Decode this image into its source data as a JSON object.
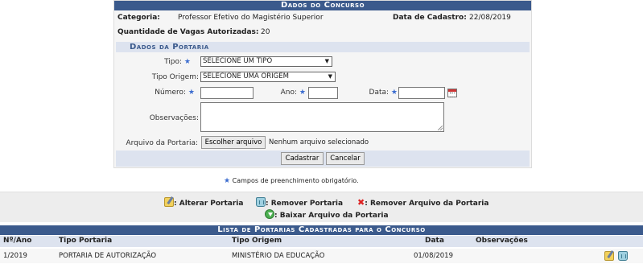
{
  "panel": {
    "title": "Dados do Concurso",
    "categoria_label": "Categoria:",
    "categoria_value": "Professor Efetivo do Magistério Superior",
    "data_cadastro_label": "Data de Cadastro:",
    "data_cadastro_value": "22/08/2019",
    "vagas_label": "Quantidade de Vagas Autorizadas:",
    "vagas_value": "20"
  },
  "portaria": {
    "title": "Dados da Portaria",
    "tipo_label": "Tipo:",
    "tipo_value": "SELECIONE UM TIPO",
    "tipo_origem_label": "Tipo Origem:",
    "tipo_origem_value": "SELECIONE UMA ORIGEM",
    "numero_label": "Número:",
    "ano_label": "Ano:",
    "data_label": "Data:",
    "observacoes_label": "Observações:",
    "arquivo_label": "Arquivo da Portaria:",
    "file_button": "Escolher arquivo",
    "file_status": "Nenhum arquivo selecionado",
    "cadastrar": "Cadastrar",
    "cancelar": "Cancelar",
    "required_mark": "★"
  },
  "required_note": "Campos de preenchimento obrigatório.",
  "legend": {
    "alterar": ": Alterar Portaria",
    "remover": ": Remover Portaria",
    "remover_arquivo": ": Remover Arquivo da Portaria",
    "baixar": ": Baixar Arquivo da Portaria"
  },
  "list": {
    "title": "Lista de Portarias Cadastradas para o Concurso",
    "columns": [
      "Nº/Ano",
      "Tipo Portaria",
      "Tipo Origem",
      "Data",
      "Observações"
    ],
    "rows": [
      {
        "num_ano": "1/2019",
        "tipo": "PORTARIA DE AUTORIZAÇÃO",
        "origem": "MINISTÉRIO DA EDUCAÇÃO",
        "data": "01/08/2019",
        "obs": ""
      }
    ]
  },
  "colors": {
    "header_blue": "#3b5a8c",
    "subheader": "#dde3ef",
    "required_star": "#3b6ccf"
  }
}
